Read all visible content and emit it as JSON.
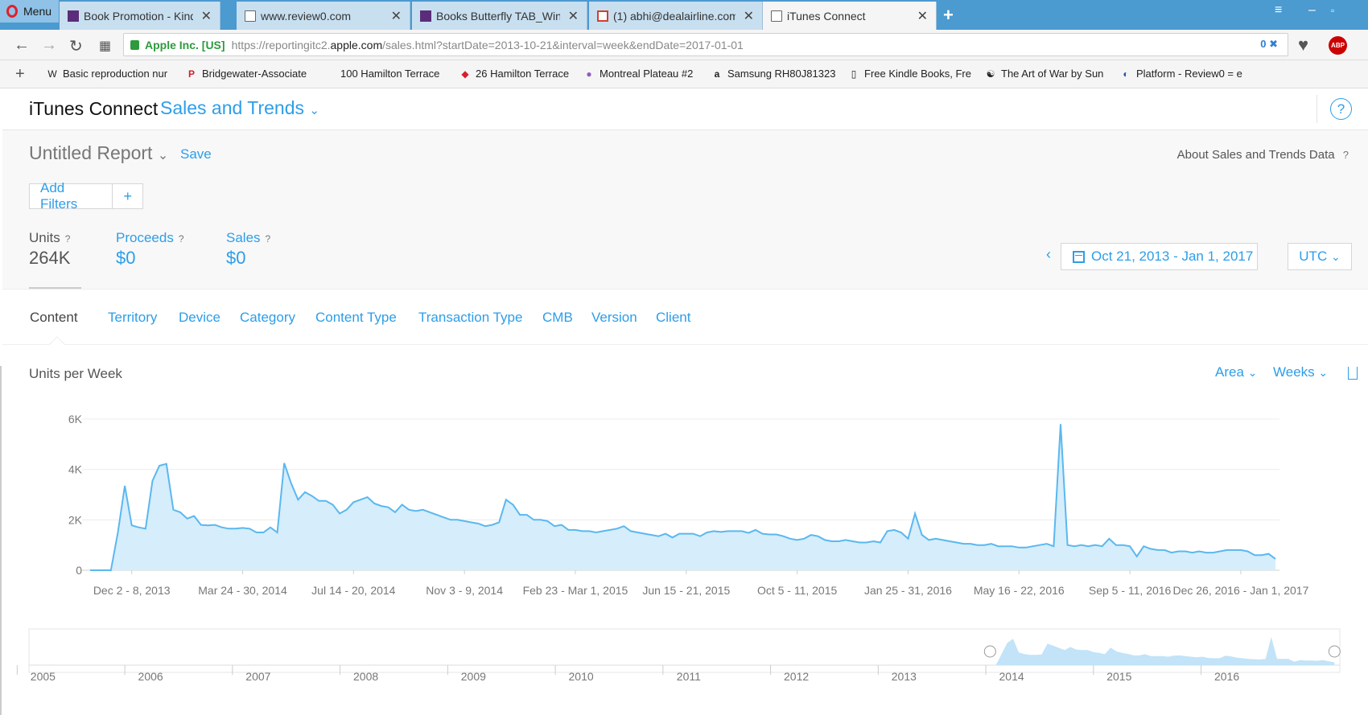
{
  "browser": {
    "menu_label": "Menu",
    "tabs": [
      {
        "title": "Book Promotion - Kindle B",
        "icon": "butterfly-icon",
        "active": false
      },
      {
        "title": "www.review0.com",
        "icon": "document-icon",
        "active": false
      },
      {
        "title": "Books Butterfly TAB_Windo",
        "icon": "butterfly-icon",
        "active": false
      },
      {
        "title": "(1) abhi@dealairline.com",
        "icon": "mail-icon",
        "active": false
      },
      {
        "title": "iTunes Connect",
        "icon": "document-icon",
        "active": true
      }
    ],
    "close_glyph": "✕",
    "cert_label": "Apple Inc. [US]",
    "url_prefix": "https://reportingitc2.",
    "url_domain": "apple.com",
    "url_path": "/sales.html?startDate=2013-10-21&interval=week&endDate=2017-01-01",
    "privacy_count": "0",
    "abp_label": "ABP",
    "bookmarks": [
      {
        "label": "Basic reproduction nur",
        "icon": "wikipedia-icon",
        "glyph": "W"
      },
      {
        "label": "Bridgewater-Associate",
        "icon": "pinterest-icon",
        "glyph": "P"
      },
      {
        "label": "100 Hamilton Terrace",
        "icon": "blank-icon",
        "glyph": ""
      },
      {
        "label": "26 Hamilton Terrace",
        "icon": "red-square-icon",
        "glyph": "◆"
      },
      {
        "label": "Montreal Plateau #2",
        "icon": "globe-icon",
        "glyph": "●"
      },
      {
        "label": "Samsung RH80J81323",
        "icon": "amazon-icon",
        "glyph": "a"
      },
      {
        "label": "Free Kindle Books, Fre",
        "icon": "document-icon",
        "glyph": "▯"
      },
      {
        "label": "The Art of War by Sun",
        "icon": "yinyang-icon",
        "glyph": "☯"
      },
      {
        "label": "Platform - Review0 = e",
        "icon": "review0-icon",
        "glyph": "◐"
      }
    ]
  },
  "header": {
    "brand": "iTunes Connect",
    "section": "Sales and Trends",
    "help": "?"
  },
  "report": {
    "title": "Untitled Report",
    "save": "Save",
    "about": "About Sales and Trends Data",
    "add_filters": "Add Filters",
    "add_plus": "+",
    "metrics": [
      {
        "name": "Units",
        "value": "264K"
      },
      {
        "name": "Proceeds",
        "value": "$0"
      },
      {
        "name": "Sales",
        "value": "$0"
      }
    ],
    "help_glyph": "?",
    "date_range": "Oct 21, 2013 - Jan 1, 2017",
    "timezone": "UTC"
  },
  "dimension_tabs": [
    "Content",
    "Territory",
    "Device",
    "Category",
    "Content Type",
    "Transaction Type",
    "CMB",
    "Version",
    "Client"
  ],
  "chart_controls": {
    "title": "Units per Week",
    "chart_type": "Area",
    "interval": "Weeks"
  },
  "colors": {
    "accent": "#2d9ee8",
    "area_fill": "#d6edfb",
    "area_line": "#5ab8ef"
  },
  "chart_data": [
    {
      "type": "area",
      "title": "Units per Week",
      "xlabel": "",
      "ylabel": "",
      "ylim": [
        0,
        6000
      ],
      "yticks": [
        0,
        2000,
        4000,
        6000
      ],
      "ytick_labels": [
        "0",
        "2K",
        "4K",
        "6K"
      ],
      "grid": true,
      "x_tick_labels": [
        "Dec 2 - 8, 2013",
        "Mar 24 - 30, 2014",
        "Jul 14 - 20, 2014",
        "Nov 3 - 9, 2014",
        "Feb 23 - Mar 1, 2015",
        "Jun 15 - 21, 2015",
        "Oct 5 - 11, 2015",
        "Jan 25 - 31, 2016",
        "May 16 - 22, 2016",
        "Sep 5 - 11, 2016",
        "Dec 26, 2016 - Jan 1, 2017"
      ],
      "x_tick_index": [
        6,
        22,
        38,
        54,
        70,
        86,
        102,
        118,
        134,
        150,
        166
      ],
      "series": [
        {
          "values": [
            0,
            0,
            0,
            0,
            1500,
            3350,
            1780,
            1700,
            1650,
            3550,
            4150,
            4220,
            2400,
            2300,
            2050,
            2150,
            1800,
            1780,
            1800,
            1700,
            1650,
            1650,
            1680,
            1650,
            1500,
            1500,
            1700,
            1500,
            4250,
            3450,
            2800,
            3100,
            2950,
            2750,
            2750,
            2600,
            2250,
            2400,
            2700,
            2800,
            2900,
            2650,
            2550,
            2500,
            2300,
            2600,
            2400,
            2350,
            2400,
            2300,
            2200,
            2100,
            2000,
            2000,
            1950,
            1900,
            1850,
            1750,
            1800,
            1900,
            2800,
            2600,
            2200,
            2200,
            2000,
            2000,
            1950,
            1750,
            1800,
            1600,
            1600,
            1550,
            1550,
            1500,
            1550,
            1600,
            1650,
            1750,
            1550,
            1500,
            1450,
            1400,
            1350,
            1450,
            1300,
            1450,
            1450,
            1450,
            1350,
            1500,
            1550,
            1520,
            1550,
            1550,
            1550,
            1480,
            1600,
            1450,
            1420,
            1420,
            1350,
            1250,
            1200,
            1250,
            1400,
            1350,
            1200,
            1150,
            1150,
            1200,
            1150,
            1100,
            1100,
            1150,
            1100,
            1550,
            1600,
            1500,
            1250,
            2250,
            1400,
            1200,
            1250,
            1200,
            1150,
            1100,
            1050,
            1050,
            1000,
            1000,
            1050,
            950,
            950,
            950,
            900,
            900,
            950,
            1000,
            1050,
            950,
            5800,
            1000,
            950,
            1000,
            950,
            1000,
            950,
            1250,
            1000,
            1000,
            950,
            550,
            950,
            850,
            800,
            800,
            700,
            750,
            750,
            700,
            750,
            700,
            700,
            750,
            800,
            800,
            800,
            750,
            600,
            600,
            650,
            450
          ]
        }
      ]
    },
    {
      "type": "area",
      "title": "",
      "x_tick_labels": [
        "2005",
        "2006",
        "2007",
        "2008",
        "2009",
        "2010",
        "2011",
        "2012",
        "2013",
        "2014",
        "2015",
        "2016"
      ],
      "selection": {
        "start_year": 2013.8,
        "end_year": 2017.0
      }
    }
  ]
}
